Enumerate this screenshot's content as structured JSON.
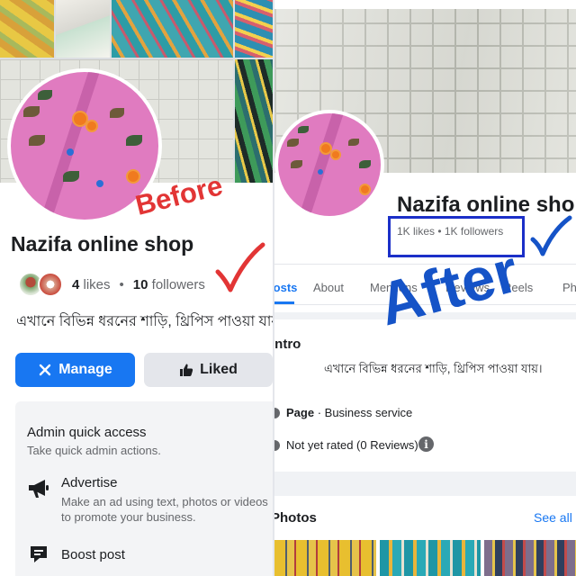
{
  "before": {
    "annotation": "Before",
    "page_name": "Nazifa online shop",
    "likes_count": "4",
    "likes_label": "likes",
    "followers_count": "10",
    "followers_label": "followers",
    "description": "এখানে বিভিন্ন ধরনের শাড়ি, থ্রিপিস পাওয়া যায়।",
    "buttons": {
      "manage": "Manage",
      "liked": "Liked"
    },
    "admin": {
      "title": "Admin quick access",
      "subtitle": "Take quick admin actions.",
      "items": [
        {
          "label": "Advertise",
          "desc_line1": "Make an ad using text, photos or videos",
          "desc_line2": "to promote your business."
        },
        {
          "label": "Boost post"
        }
      ]
    }
  },
  "after": {
    "annotation": "After",
    "page_name": "Nazifa online shop",
    "stats": "1K likes • 1K followers",
    "tabs": [
      "Posts",
      "About",
      "Mentions",
      "Reviews",
      "Reels",
      "Photos"
    ],
    "intro": {
      "title": "Intro",
      "description": "এখানে বিভিন্ন ধরনের শাড়ি, থ্রিপিস পাওয়া যায়।",
      "page_label": "Page",
      "category": "· Business service",
      "rating": "Not yet rated (0 Reviews)",
      "info_glyph": "i"
    },
    "photos": {
      "title": "Photos",
      "see_all": "See all"
    }
  },
  "colors": {
    "accent": "#1877f2",
    "before_annotation": "#e23535",
    "after_annotation": "#1553c7",
    "highlight_box": "#1b2fc8"
  },
  "icons": {
    "manage": "gear-icon",
    "liked": "thumbs-up-icon",
    "advertise": "megaphone-icon",
    "boost": "boost-post-icon",
    "checkmark": "checkmark-icon",
    "info": "info-icon"
  }
}
